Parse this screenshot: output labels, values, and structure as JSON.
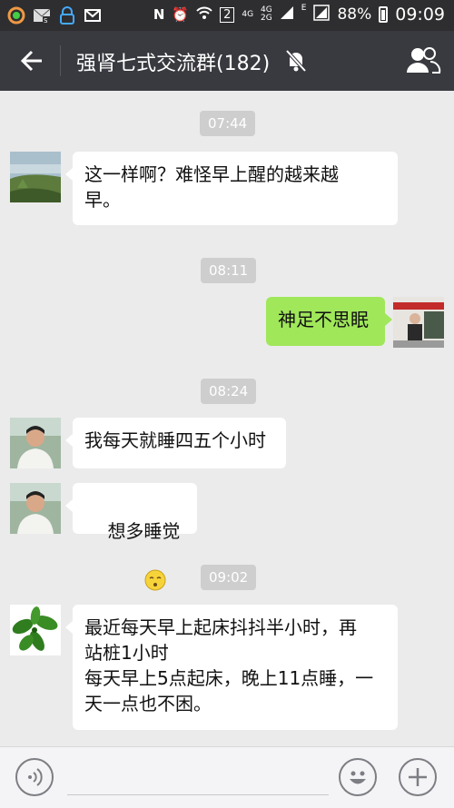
{
  "statusbar": {
    "network": "4G",
    "network2": "4G",
    "network3": "2G",
    "sim": "2",
    "e_label": "E",
    "battery": "88%",
    "time": "09:09"
  },
  "header": {
    "title": "强肾七式交流群(182)"
  },
  "messages": [
    {
      "type": "time",
      "text": "07:44"
    },
    {
      "type": "left",
      "text": "这一样啊？难怪早上醒的越来越\n早。"
    },
    {
      "type": "time",
      "text": "08:11"
    },
    {
      "type": "right",
      "text": "神足不思眠"
    },
    {
      "type": "time",
      "text": "08:24"
    },
    {
      "type": "left",
      "text": "我每天就睡四五个小时"
    },
    {
      "type": "left",
      "text": "想多睡觉"
    },
    {
      "type": "time",
      "text": "09:02"
    },
    {
      "type": "left",
      "text": "最近每天早上起床抖抖半小时，再\n站桩1小时\n每天早上5点起床，晚上11点睡，一\n天一点也不困。"
    }
  ]
}
